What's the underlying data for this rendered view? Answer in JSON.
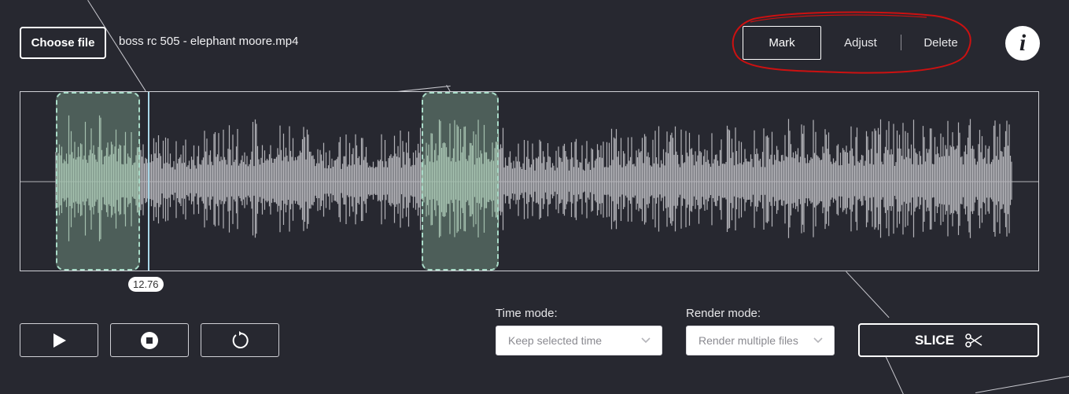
{
  "file": {
    "choose_label": "Choose file",
    "name": "boss rc 505 - elephant moore.mp4"
  },
  "modes": {
    "items": [
      "Mark",
      "Adjust",
      "Delete"
    ],
    "active": "Mark"
  },
  "info_label": "i",
  "waveform": {
    "cursor_time": "12.76",
    "cursor_fraction": 0.125,
    "regions": [
      {
        "start_fraction": 0.035,
        "end_fraction": 0.118
      },
      {
        "start_fraction": 0.394,
        "end_fraction": 0.47
      }
    ],
    "wave_color": "#b3b3b8",
    "region_wave_color": "#c6dccd"
  },
  "transport": {
    "play_icon": "play-icon",
    "stop_icon": "stop-icon",
    "restart_icon": "restart-icon"
  },
  "time_mode": {
    "label": "Time mode:",
    "value": "Keep selected time"
  },
  "render_mode": {
    "label": "Render mode:",
    "value": "Render multiple files"
  },
  "slice": {
    "label": "SLICE",
    "icon": "scissors-icon"
  },
  "colors": {
    "background": "#272830",
    "accent_annotation": "#cc1111"
  }
}
